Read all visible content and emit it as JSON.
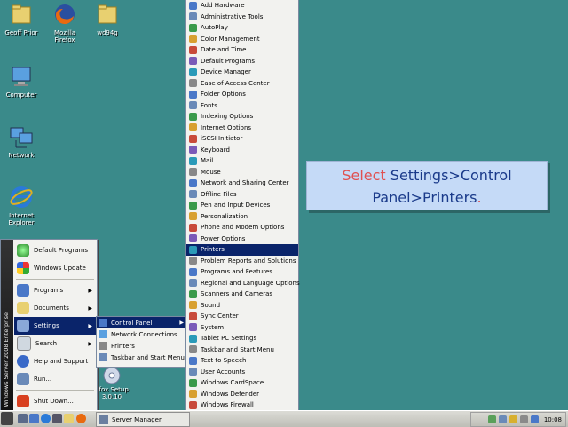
{
  "desktop": {
    "icons": [
      {
        "label": "Geoff Prior",
        "icon": "folder-icon"
      },
      {
        "label": "Mozilla Firefox",
        "icon": "firefox-icon"
      },
      {
        "label": "wd94g",
        "icon": "folder-icon"
      },
      {
        "label": "Computer",
        "icon": "computer-icon"
      },
      {
        "label": "Network",
        "icon": "network-icon"
      },
      {
        "label": "Internet Explorer",
        "icon": "ie-icon"
      },
      {
        "label": "efox Setup 3.0.10",
        "icon": "setup-icon"
      }
    ]
  },
  "start_menu": {
    "band_text": "Windows Server 2008 Enterprise",
    "items": [
      {
        "label": "Default Programs",
        "icon": "default-programs-icon"
      },
      {
        "label": "Windows Update",
        "icon": "windows-update-icon"
      },
      {
        "label": "Programs",
        "icon": "programs-icon",
        "submenu": true
      },
      {
        "label": "Documents",
        "icon": "documents-icon",
        "submenu": true
      },
      {
        "label": "Settings",
        "icon": "settings-icon",
        "submenu": true,
        "selected": true
      },
      {
        "label": "Search",
        "icon": "search-icon",
        "submenu": true
      },
      {
        "label": "Help and Support",
        "icon": "help-icon"
      },
      {
        "label": "Run...",
        "icon": "run-icon"
      },
      {
        "label": "Shut Down...",
        "icon": "shutdown-icon"
      }
    ]
  },
  "settings_menu": {
    "items": [
      {
        "label": "Control Panel",
        "selected": true,
        "submenu": true
      },
      {
        "label": "Network Connections"
      },
      {
        "label": "Printers"
      },
      {
        "label": "Taskbar and Start Menu"
      }
    ]
  },
  "control_panel_menu": {
    "items": [
      "Add Hardware",
      "Administrative Tools",
      "AutoPlay",
      "Color Management",
      "Date and Time",
      "Default Programs",
      "Device Manager",
      "Ease of Access Center",
      "Folder Options",
      "Fonts",
      "Indexing Options",
      "Internet Options",
      "iSCSI Initiator",
      "Keyboard",
      "Mail",
      "Mouse",
      "Network and Sharing Center",
      "Offline Files",
      "Pen and Input Devices",
      "Personalization",
      "Phone and Modem Options",
      "Power Options",
      "Printers",
      "Problem Reports and Solutions",
      "Programs and Features",
      "Regional and Language Options",
      "Scanners and Cameras",
      "Sound",
      "Sync Center",
      "System",
      "Tablet PC Settings",
      "Taskbar and Start Menu",
      "Text to Speech",
      "User Accounts",
      "Windows CardSpace",
      "Windows Defender",
      "Windows Firewall",
      "Windows SideShow"
    ],
    "selected": "Printers"
  },
  "callout": {
    "part1": "Select",
    "part2": " Settings>Control Panel>Printers",
    "part3": "."
  },
  "taskbar": {
    "task_label": "Server Manager",
    "clock": "10:08"
  },
  "colors": {
    "desktop": "#3a8a8a",
    "selection": "#0a246a",
    "callout_bg": "#c5daf7"
  }
}
